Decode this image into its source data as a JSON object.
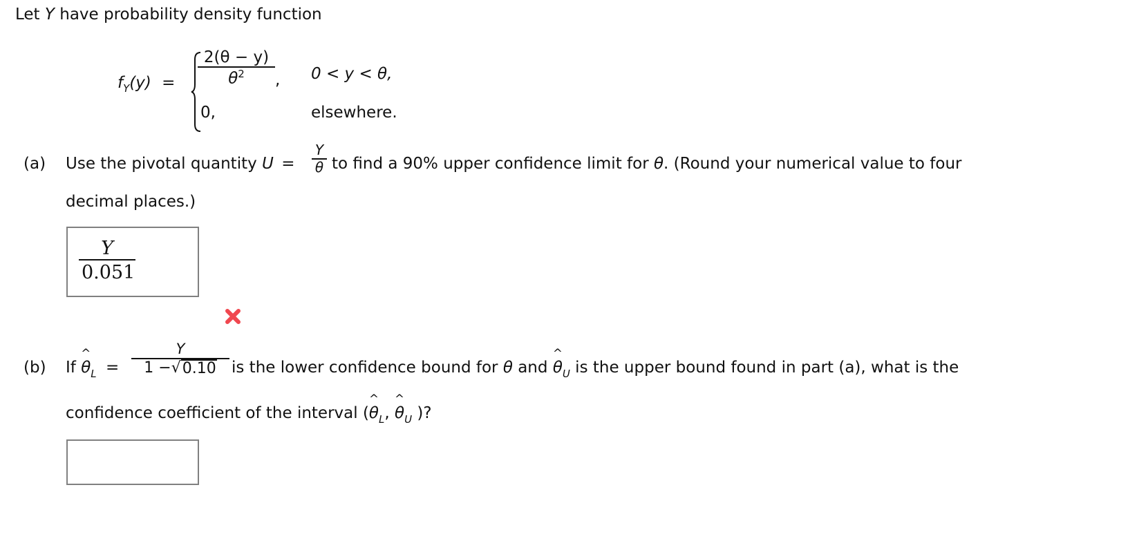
{
  "intro": {
    "text_before": "Let ",
    "var": "Y",
    "text_after": " have probability density function"
  },
  "pdf": {
    "lhs_f": "f",
    "lhs_sub": "Y",
    "lhs_arg": "(y)",
    "equals": "=",
    "case1_numerator": "2(θ − y)",
    "case1_denominator_base": "θ",
    "case1_denominator_exp": "2",
    "case1_comma": ",",
    "case1_condition": "0 < y < θ,",
    "case2_value": "0,",
    "case2_condition": "elsewhere."
  },
  "part_a": {
    "label": "(a)",
    "text_before": "Use the pivotal quantity ",
    "pivot_var": "U",
    "equals": "=",
    "pivot_num": "Y",
    "pivot_den": "θ",
    "text_after_1": " to find a 90% upper confidence limit for ",
    "theta": "θ",
    "text_after_2": ". (Round your numerical value to four",
    "text_line2": "decimal places.)",
    "answer": {
      "numerator": "Y",
      "denominator": "0.051",
      "status": "incorrect",
      "status_color": "#f0474f"
    }
  },
  "part_b": {
    "label": "(b)",
    "if_text": "If ",
    "theta_hat": "θ",
    "sub_L": "L",
    "equals": "=",
    "frac_num": "Y",
    "frac_den_prefix": "1 −",
    "frac_den_radicand": "0.10",
    "text_1": " is the lower confidence bound for ",
    "theta": "θ",
    "text_2": " and ",
    "sub_U": "U",
    "text_3": " is the upper bound found in part (a), what is the",
    "line2_text": "confidence coefficient of the interval (",
    "line2_comma": ", ",
    "line2_close": " )?",
    "answer_value": ""
  }
}
